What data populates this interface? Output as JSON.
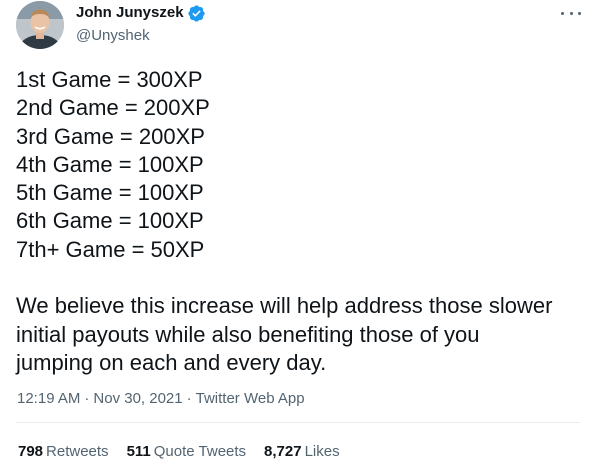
{
  "author": {
    "display_name": "John Junyszek",
    "handle": "@Unyshek",
    "verified_icon": "verified-badge-icon",
    "verified_color": "#1d9bf0"
  },
  "tweet": {
    "lines": [
      "1st Game = 300XP",
      "2nd Game = 200XP",
      "3rd Game = 200XP",
      "4th Game = 100XP",
      "5th Game = 100XP",
      "6th Game = 100XP",
      "7th+ Game = 50XP"
    ],
    "paragraph_lines": [
      "We believe this increase will help address those slower",
      "initial payouts while also benefiting those of you",
      "jumping on each and every day."
    ]
  },
  "meta": {
    "time": "12:19 AM",
    "separator": "·",
    "date": "Nov 30, 2021",
    "source": "Twitter Web App"
  },
  "stats": {
    "retweets": {
      "count": "798",
      "label": "Retweets"
    },
    "quote_tweets": {
      "count": "511",
      "label": "Quote Tweets"
    },
    "likes": {
      "count": "8,727",
      "label": "Likes"
    }
  },
  "colors": {
    "text": "#0f1419",
    "secondary": "#536471",
    "divider": "#e6ecf0"
  }
}
